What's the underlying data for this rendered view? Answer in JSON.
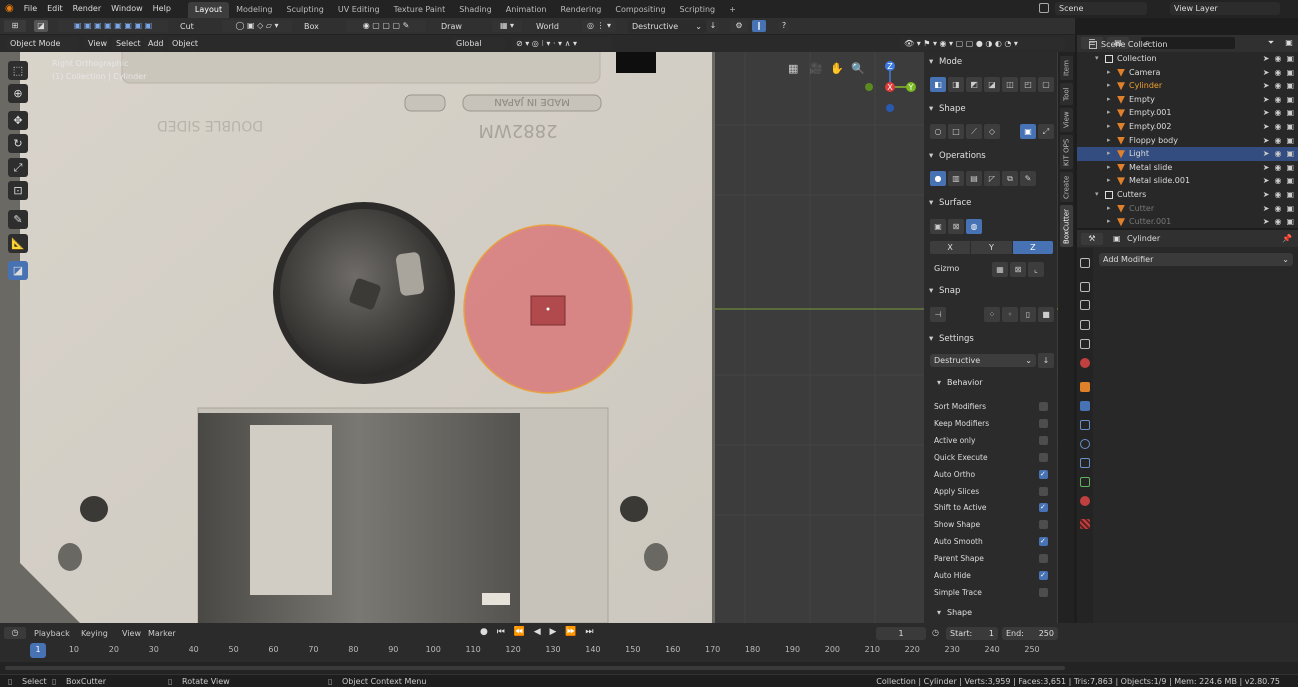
{
  "topbar": {
    "menus": [
      "File",
      "Edit",
      "Render",
      "Window",
      "Help"
    ],
    "workspaces": [
      "Layout",
      "Modeling",
      "Sculpting",
      "UV Editing",
      "Texture Paint",
      "Shading",
      "Animation",
      "Rendering",
      "Compositing",
      "Scripting"
    ],
    "active_workspace": "Layout",
    "add_tab": "+",
    "scene": "Scene",
    "view_layer": "View Layer"
  },
  "toolhdr": {
    "mode": "Cut",
    "shape": "Box",
    "draw": "Draw",
    "orientation": "World",
    "behavior": "Destructive"
  },
  "vphdr": {
    "mode": "Object Mode",
    "view": "View",
    "select": "Select",
    "add": "Add",
    "object": "Object",
    "transform": "Global"
  },
  "viewport": {
    "view_name": "Right Orthographic",
    "collection_info": "(1) Collection | Cylinder",
    "image_text_top": "MADE IN JAPAN",
    "image_text_code": "2882WM",
    "image_text_small": "DOUBLE SIDED",
    "gizmo": {
      "x": "X",
      "y": "Y",
      "z": "Z"
    }
  },
  "npanel": {
    "sections": {
      "mode": "Mode",
      "shape": "Shape",
      "operations": "Operations",
      "surface": "Surface",
      "snap": "Snap",
      "settings": "Settings",
      "behavior": "Behavior",
      "shape2": "Shape"
    },
    "axes": [
      "X",
      "Y",
      "Z"
    ],
    "active_axis": "Z",
    "gizmo_label": "Gizmo",
    "settings_mode": "Destructive",
    "behavior_options": [
      {
        "label": "Sort Modifiers",
        "checked": false
      },
      {
        "label": "Keep Modifiers",
        "checked": false
      },
      {
        "label": "Active only",
        "checked": false
      },
      {
        "label": "Quick Execute",
        "checked": false
      },
      {
        "label": "Auto Ortho",
        "checked": true
      },
      {
        "label": "Apply Slices",
        "checked": false
      },
      {
        "label": "Shift to Active",
        "checked": true
      },
      {
        "label": "Show Shape",
        "checked": false
      },
      {
        "label": "Auto Smooth",
        "checked": true
      },
      {
        "label": "Parent Shape",
        "checked": false
      },
      {
        "label": "Auto Hide",
        "checked": true
      },
      {
        "label": "Simple Trace",
        "checked": false
      }
    ]
  },
  "vtabs": [
    "Item",
    "Tool",
    "View",
    "KIT OPS",
    "Create",
    "BoxCutter"
  ],
  "outliner": {
    "root": "Scene Collection",
    "rows": [
      {
        "label": "Collection",
        "indent": 1,
        "type": "collection",
        "selected": false
      },
      {
        "label": "Camera",
        "indent": 2,
        "type": "camera",
        "selected": false
      },
      {
        "label": "Cylinder",
        "indent": 2,
        "type": "mesh",
        "selected": false,
        "active": true
      },
      {
        "label": "Empty",
        "indent": 2,
        "type": "empty",
        "selected": false
      },
      {
        "label": "Empty.001",
        "indent": 2,
        "type": "empty",
        "selected": false
      },
      {
        "label": "Empty.002",
        "indent": 2,
        "type": "empty",
        "selected": false
      },
      {
        "label": "Floppy body",
        "indent": 2,
        "type": "mesh",
        "selected": false
      },
      {
        "label": "Light",
        "indent": 2,
        "type": "light",
        "selected": true
      },
      {
        "label": "Metal slide",
        "indent": 2,
        "type": "mesh",
        "selected": false
      },
      {
        "label": "Metal slide.001",
        "indent": 2,
        "type": "mesh",
        "selected": false
      },
      {
        "label": "Cutters",
        "indent": 1,
        "type": "collection",
        "selected": false
      },
      {
        "label": "Cutter",
        "indent": 2,
        "type": "mesh",
        "selected": false,
        "dim": true
      },
      {
        "label": "Cutter.001",
        "indent": 2,
        "type": "mesh",
        "selected": false,
        "dim": true
      }
    ]
  },
  "properties": {
    "object_name": "Cylinder",
    "add_modifier": "Add Modifier"
  },
  "timeline": {
    "menus": [
      "Playback",
      "Keying",
      "View",
      "Marker"
    ],
    "current_frame": "1",
    "start_label": "Start:",
    "start": "1",
    "end_label": "End:",
    "end": "250",
    "ticks": [
      "1",
      "10",
      "20",
      "30",
      "40",
      "50",
      "60",
      "70",
      "80",
      "90",
      "100",
      "110",
      "120",
      "130",
      "140",
      "150",
      "160",
      "170",
      "180",
      "190",
      "200",
      "210",
      "220",
      "230",
      "240",
      "250"
    ]
  },
  "status": {
    "select": "Select",
    "boxcutter": "BoxCutter",
    "rotate": "Rotate View",
    "context": "Object Context Menu",
    "stats": "Collection | Cylinder | Verts:3,959 | Faces:3,651 | Tris:7,863 | Objects:1/9 | Mem: 224.6 MB | v2.80.75"
  },
  "colors": {
    "accent": "#4772b3",
    "selected_row": "#334d80",
    "cut_shape_fill": "#d9797a",
    "cut_shape_stroke": "#e8a040",
    "floppy_body": "#d6d1c8"
  }
}
